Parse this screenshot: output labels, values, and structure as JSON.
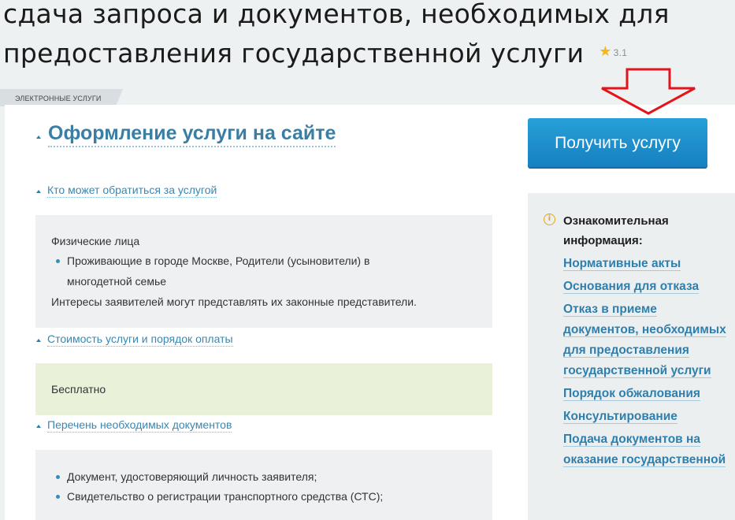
{
  "page": {
    "title": "сдача запроса и документов, необходимых для предоставления государственной услуги",
    "rating": "3.1",
    "section_tab": "ЭЛЕКТРОННЫЕ УСЛУГИ"
  },
  "main": {
    "heading": "Оформление услуги на сайте",
    "sections": [
      {
        "title": "Кто может обратиться за услугой",
        "content": {
          "line1": "Физические лица",
          "bullet1_line1": "Проживающие в городе Москве, Родители (усыновители) в",
          "bullet1_line2": "многодетной семье",
          "line2": "Интересы заявителей могут представлять их законные представители."
        }
      },
      {
        "title": "Стоимость услуги и порядок оплаты",
        "content": {
          "line1": "Бесплатно"
        }
      },
      {
        "title": "Перечень необходимых документов",
        "content": {
          "bullet1": "Документ, удостоверяющий личность заявителя;",
          "bullet2": "Свидетельство о регистрации транспортного средства (СТС);"
        }
      }
    ]
  },
  "sidebar": {
    "cta_label": "Получить услугу",
    "info_title": "Ознакомительная информация:",
    "links": [
      "Нормативные акты",
      "Основания для отказа",
      "Отказ в приеме документов, необходимых для предоставления государственной услуги",
      "Порядок обжалования",
      "Консультирование",
      "Подача документов на оказание государственной"
    ]
  },
  "colors": {
    "accent": "#3a7fa3",
    "cta": "#1c8fcd",
    "annotation_arrow": "#e3141c",
    "star": "#f4b619"
  },
  "icons": {
    "rating": "star-icon",
    "info": "info-circle-icon",
    "collapse": "caret-up-icon"
  }
}
